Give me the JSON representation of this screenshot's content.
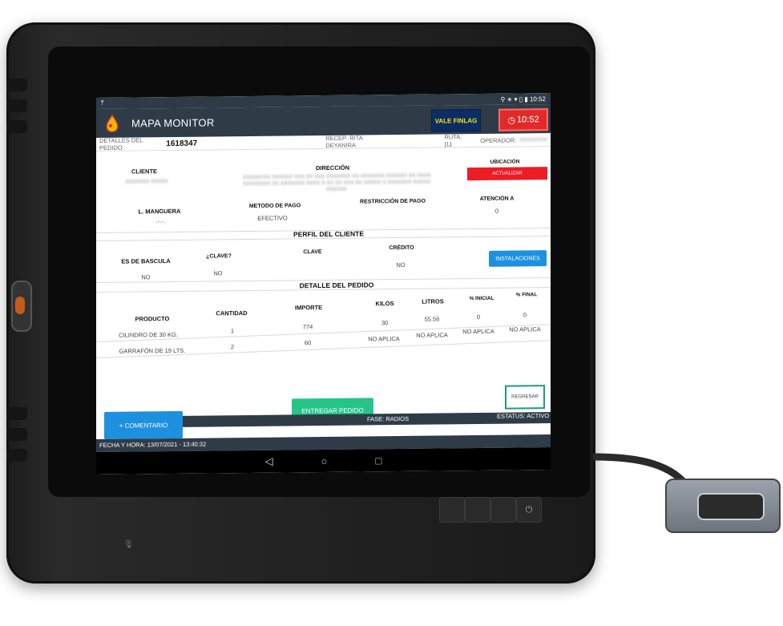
{
  "statusbar": {
    "left_icon": "upload-icon",
    "time": "10:52",
    "icons": "⚲ ∗ ▾ ▯ ▮"
  },
  "app": {
    "title": "MAPA  MONITOR",
    "vale_label": "VALE FINLAG",
    "timer": "10:52"
  },
  "details": {
    "label": "DETALLES DEL PEDIDO:",
    "number": "1618347",
    "recep": "RECEP: RITA DEYANIRA",
    "ruta": "RUTA: [11",
    "operador_label": "OPERADOR:"
  },
  "info": {
    "cliente_label": "CLIENTE",
    "direccion_label": "DIRECCIÓN",
    "ubicacion_label": "UBICACIÓN",
    "actualizar_label": "ACTUALIZAR",
    "manguera_label": "L. MANGUERA",
    "manguera_value": ".-.-.",
    "metodo_label": "METODO DE PAGO",
    "metodo_value": "EFECTIVO",
    "restriccion_label": "RESTRICCIÓN DE PAGO",
    "atencion_label": "ATENCIÓN A",
    "atencion_value": "0"
  },
  "perfil": {
    "title": "PERFIL DEL CLIENTE",
    "bascula_label": "ES DE BASCULA",
    "bascula_value": "NO",
    "clave_q_label": "¿CLAVE?",
    "clave_q_value": "NO",
    "clave_label": "CLAVE",
    "credito_label": "CRÉDITO",
    "credito_value": "NO",
    "instalaciones_label": "INSTALACIONES"
  },
  "detalle": {
    "title": "DETALLE DEL PEDIDO",
    "headers": [
      "PRODUCTO",
      "CANTIDAD",
      "IMPORTE",
      "KILOS",
      "LITROS",
      "% INICIAL",
      "% FINAL"
    ],
    "rows": [
      [
        "CILINDRO DE 30 KG.",
        "1",
        "774",
        "30",
        "55.56",
        "0",
        "0"
      ],
      [
        "GARRAFÓN DE 19 LTS.",
        "2",
        "60",
        "NO APLICA",
        "NO APLICA",
        "NO APLICA",
        "NO APLICA"
      ]
    ]
  },
  "actions": {
    "comentario_label": "+ COMENTARIO",
    "entregar_label": "ENTREGAR PEDIDO",
    "regresar_label": "REGRESAR"
  },
  "footer": {
    "fase": "FASE: RADIOS",
    "estatus": "ESTATUS: ACTIVO",
    "fecha": "FECHA Y HORA: 13/07/2021 - 13:40:32"
  },
  "nav": {
    "back": "◁",
    "home": "○",
    "recent": "□"
  },
  "colors": {
    "appbar": "#2f3c47",
    "vale_bg": "#0c2d63",
    "timer_bg": "#e02a2a",
    "green": "#27c48a",
    "blue": "#1e90e0",
    "red": "#ee1c25"
  }
}
